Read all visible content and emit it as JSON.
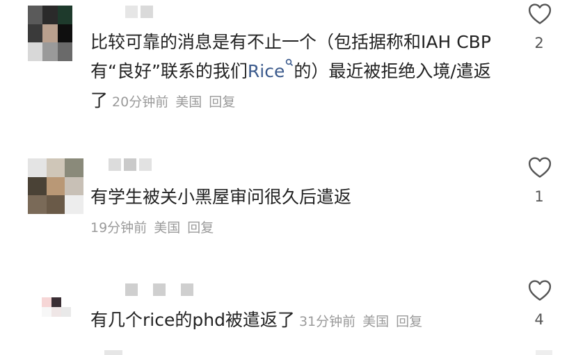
{
  "comments": [
    {
      "avatar_colors": [
        "#5a5a5a",
        "#2a2a2a",
        "#1e3a2c",
        "#3a3a3a",
        "#b9a08e",
        "#0f0f0f",
        "#d8d8d8",
        "#9a9a9a",
        "#6a6a6a"
      ],
      "name_blur_colors": [
        "#e6e6e6",
        "#dadada"
      ],
      "text_before_link": "比较可靠的消息是有不止一个（包括据称和IAH CBP有“良好”联系的我们",
      "link_text": "Rice",
      "text_after_link": "的）最近被拒绝入境/遣返了",
      "time": "20分钟前",
      "location": "美国",
      "reply_label": "回复",
      "like_count": "2"
    },
    {
      "avatar_colors": [
        "#e4e4e4",
        "#cfc6b8",
        "#8a8a7a",
        "#4a4236",
        "#b99876",
        "#c8c0b6",
        "#7a6a58",
        "#6a5a48",
        "#ededed"
      ],
      "name_blur_colors": [
        "#dcdcdc",
        "#cacaca",
        "#e2e2e2"
      ],
      "text": "有学生被关小黑屋审问很久后遣返",
      "time": "19分钟前",
      "location": "美国",
      "reply_label": "回复",
      "like_count": "1"
    },
    {
      "avatar_colors": [
        "#f6d6d6",
        "#3a2e34",
        "#ffffff",
        "#f7f7f7",
        "#efe6e6",
        "#e9e9e9",
        "#ffffff",
        "#ffffff",
        "#ffffff"
      ],
      "name_blur_colors": [
        "#cfcfcf",
        "#cfcfcf",
        "#cfcfcf"
      ],
      "text": "有几个rice的phd被遣返了",
      "time": "31分钟前",
      "location": "美国",
      "reply_label": "回复",
      "like_count": "4"
    }
  ],
  "icons": {
    "like": "heart-outline-icon",
    "link_search": "search-icon"
  },
  "colors": {
    "text": "#222222",
    "meta": "#9a9a9a",
    "link": "#3b5a8c",
    "icon": "#555555"
  }
}
